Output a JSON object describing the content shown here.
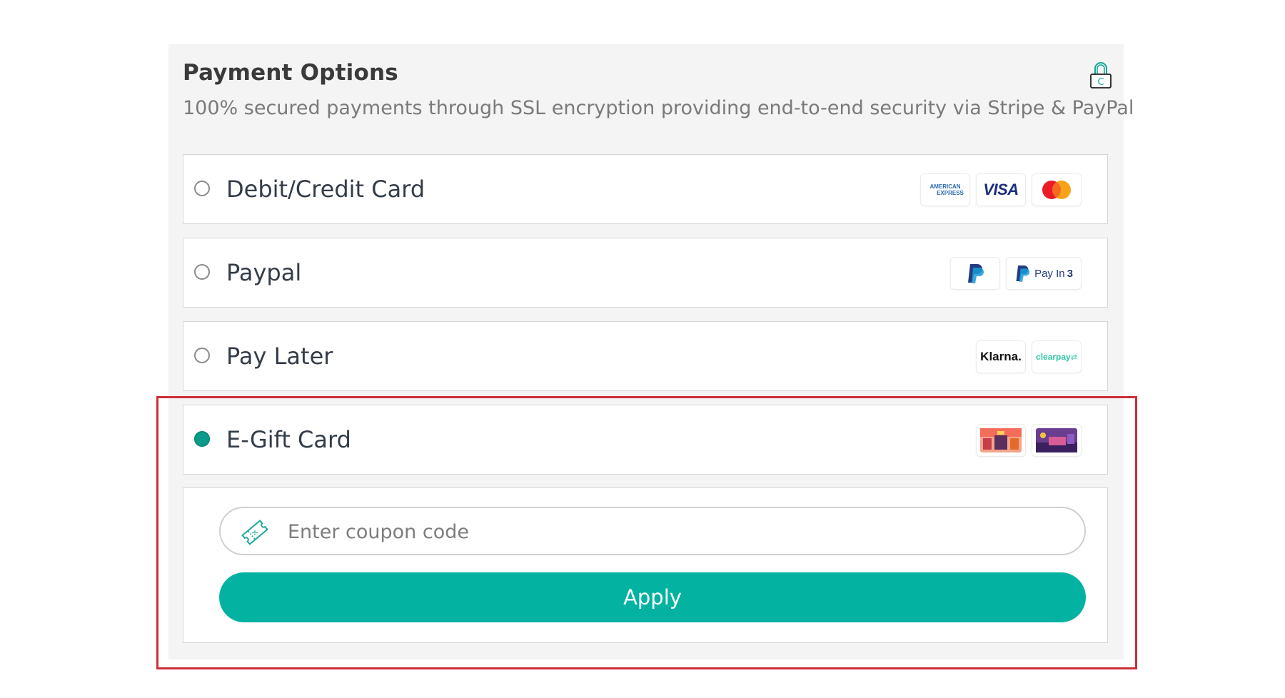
{
  "header": {
    "title": "Payment Options",
    "subtitle": "100% secured payments through SSL encryption providing end-to-end security via Stripe & PayPal",
    "lock_icon": "lock-icon"
  },
  "options": [
    {
      "label": "Debit/Credit Card",
      "selected": false,
      "logos": [
        "american-express-logo",
        "visa-logo",
        "mastercard-logo"
      ],
      "amex_line1": "AMERICAN",
      "amex_line2": "EXPRESS",
      "visa_text": "VISA"
    },
    {
      "label": "Paypal",
      "selected": false,
      "logos": [
        "paypal-logo",
        "paypal-pay-in-3-logo"
      ],
      "payin3_text": "Pay In",
      "payin3_number": "3"
    },
    {
      "label": "Pay Later",
      "selected": false,
      "logos": [
        "klarna-logo",
        "clearpay-logo"
      ],
      "klarna_text": "Klarna.",
      "clearpay_text": "clearpay"
    },
    {
      "label": "E-Gift Card",
      "selected": true,
      "logos": [
        "gift-card-image-1",
        "gift-card-image-2"
      ]
    }
  ],
  "coupon": {
    "placeholder": "Enter coupon code",
    "value": "",
    "icon": "coupon-ticket-icon",
    "apply_label": "Apply"
  },
  "colors": {
    "accent": "#04b2a2",
    "selected_radio": "#0a9c8a",
    "highlight_border": "#cc2f3a",
    "panel_bg": "#f4f4f4"
  }
}
